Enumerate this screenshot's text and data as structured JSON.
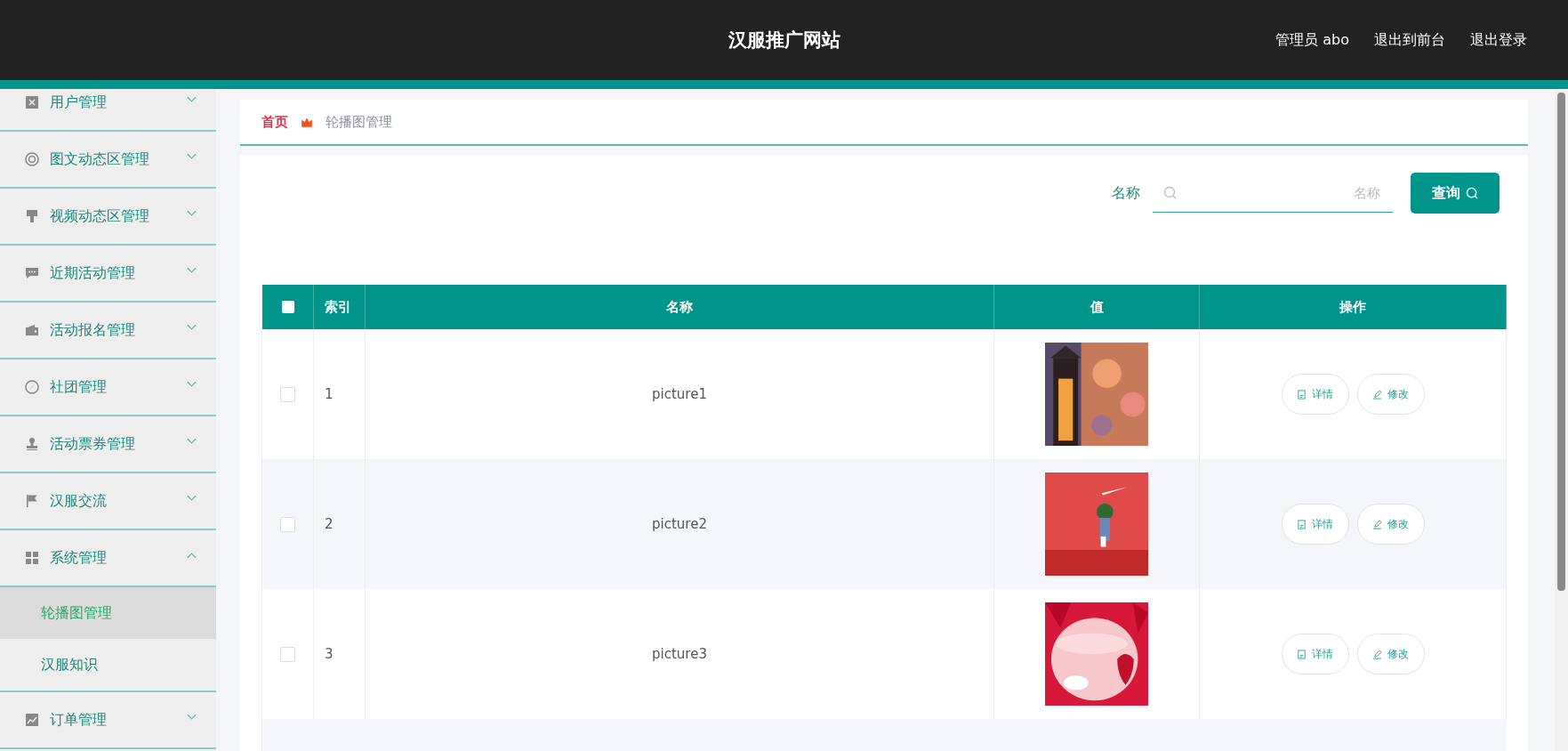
{
  "header": {
    "title": "汉服推广网站",
    "links": [
      "管理员 abo",
      "退出到前台",
      "退出登录"
    ]
  },
  "sidebar": {
    "items": [
      {
        "label": "用户管理",
        "expanded": false
      },
      {
        "label": "图文动态区管理",
        "expanded": false
      },
      {
        "label": "视频动态区管理",
        "expanded": false
      },
      {
        "label": "近期活动管理",
        "expanded": false
      },
      {
        "label": "活动报名管理",
        "expanded": false
      },
      {
        "label": "社团管理",
        "expanded": false
      },
      {
        "label": "活动票券管理",
        "expanded": false
      },
      {
        "label": "汉服交流",
        "expanded": false
      },
      {
        "label": "系统管理",
        "expanded": true,
        "children": [
          {
            "label": "轮播图管理",
            "selected": true
          },
          {
            "label": "汉服知识",
            "selected": false
          }
        ]
      },
      {
        "label": "订单管理",
        "expanded": false
      }
    ]
  },
  "breadcrumb": [
    "首页",
    "轮播图管理"
  ],
  "search": {
    "label": "名称",
    "placeholder": "名称",
    "button": "查询"
  },
  "table": {
    "columns": [
      "索引",
      "名称",
      "值",
      "操作"
    ],
    "select_all_checked": false,
    "rows": [
      {
        "checked": false,
        "index": "1",
        "name": "picture1",
        "value": {
          "kind": "picture"
        },
        "actions": [
          "详情",
          "修改"
        ]
      },
      {
        "checked": false,
        "index": "2",
        "name": "picture2",
        "value": {
          "kind": "picture"
        },
        "actions": [
          "详情",
          "修改"
        ]
      },
      {
        "checked": false,
        "index": "3",
        "name": "picture3",
        "value": {
          "kind": "picture"
        },
        "actions": [
          "详情",
          "修改"
        ]
      }
    ]
  }
}
